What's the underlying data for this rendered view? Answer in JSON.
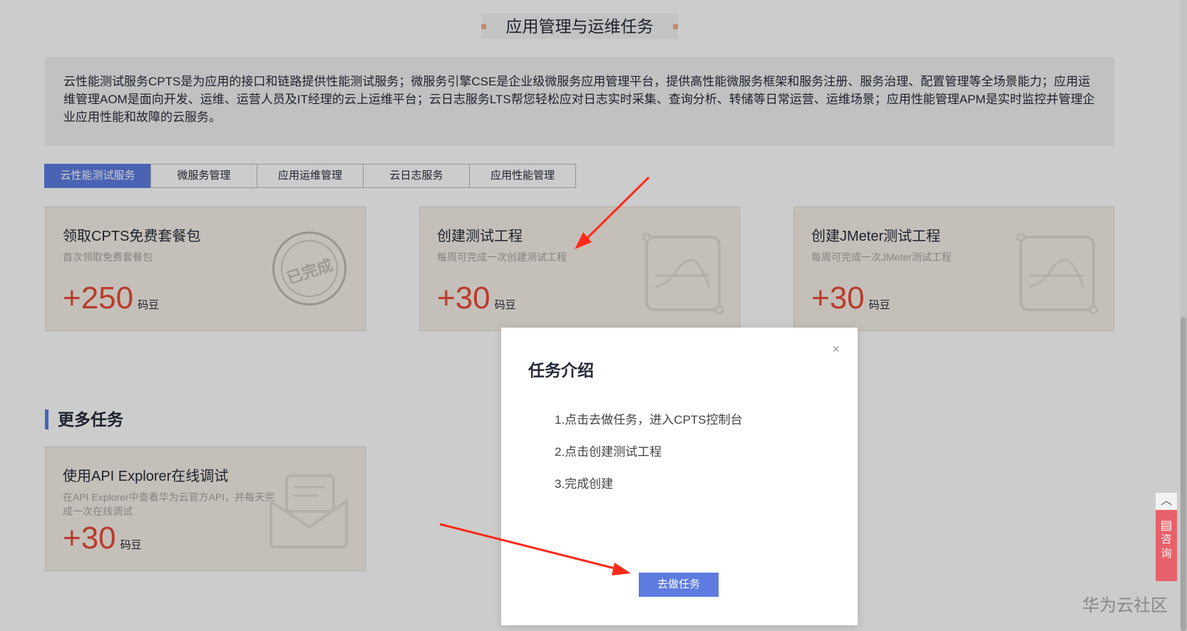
{
  "section_title": "应用管理与运维任务",
  "intro": "云性能测试服务CPTS是为应用的接口和链路提供性能测试服务；微服务引擎CSE是企业级微服务应用管理平台，提供高性能微服务框架和服务注册、服务治理、配置管理等全场景能力；应用运维管理AOM是面向开发、运维、运营人员及IT经理的云上运维平台；云日志服务LTS帮您轻松应对日志实时采集、查询分析、转储等日常运营、运维场景；应用性能管理APM是实时监控并管理企业应用性能和故障的云服务。",
  "tabs": [
    "云性能测试服务",
    "微服务管理",
    "应用运维管理",
    "云日志服务",
    "应用性能管理"
  ],
  "cards": [
    {
      "title": "领取CPTS免费套餐包",
      "desc": "首次领取免费套餐包",
      "points": "+250",
      "unit": "码豆",
      "stamp": "已完成"
    },
    {
      "title": "创建测试工程",
      "desc": "每周可完成一次创建测试工程",
      "points": "+30",
      "unit": "码豆"
    },
    {
      "title": "创建JMeter测试工程",
      "desc": "每周可完成一次JMeter测试工程",
      "points": "+30",
      "unit": "码豆"
    }
  ],
  "more": {
    "title": "更多任务",
    "card": {
      "title": "使用API Explorer在线调试",
      "desc": "在API Explorer中查看华为云官方API，并每天完成一次在线调试",
      "points": "+30",
      "unit": "码豆"
    }
  },
  "modal": {
    "title": "任务介绍",
    "close": "×",
    "steps": [
      "1.点击去做任务，进入CPTS控制台",
      "2.点击创建测试工程",
      "3.完成创建"
    ],
    "button": "去做任务"
  },
  "float": {
    "top": "︿",
    "consult_icon": "▤",
    "consult_a": "咨",
    "consult_b": "询"
  },
  "watermark": "华为云社区",
  "colors": {
    "accent": "#5e7ce0",
    "points": "#e84b3a",
    "arrow": "#ff2a1a"
  }
}
